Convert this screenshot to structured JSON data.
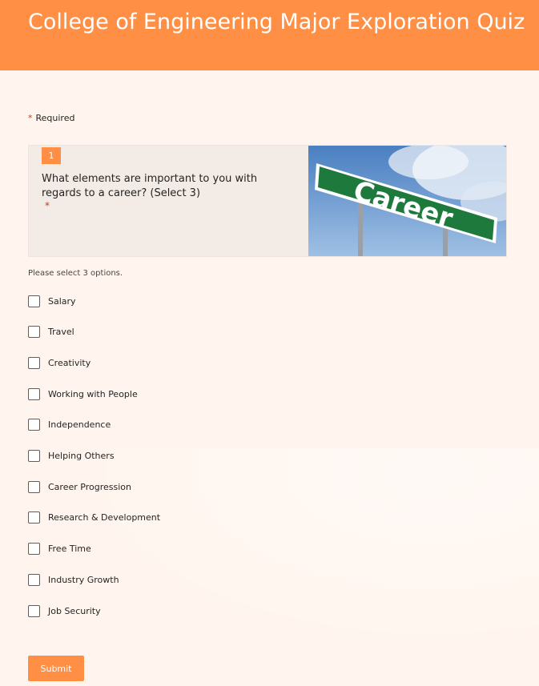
{
  "header": {
    "title": "College of Engineering Major Exploration Quiz"
  },
  "required_note": {
    "star": "*",
    "label": "Required"
  },
  "question": {
    "number": "1",
    "text": "What elements are important to you with regards to a career? (Select 3)",
    "required_star": "*",
    "image_sign_text": "Career",
    "hint": "Please select 3 options.",
    "options": [
      "Salary",
      "Travel",
      "Creativity",
      "Working with People",
      "Independence",
      "Helping Others",
      "Career Progression",
      "Research & Development",
      "Free Time",
      "Industry Growth",
      "Job Security"
    ]
  },
  "submit": {
    "label": "Submit"
  },
  "colors": {
    "accent": "#ff8f45",
    "background": "#fff5ee",
    "card": "#f3ebe6",
    "required": "#c43e1c",
    "sign_green": "#1e7a3c"
  },
  "icons": {
    "checkbox": "checkbox-empty-icon"
  }
}
